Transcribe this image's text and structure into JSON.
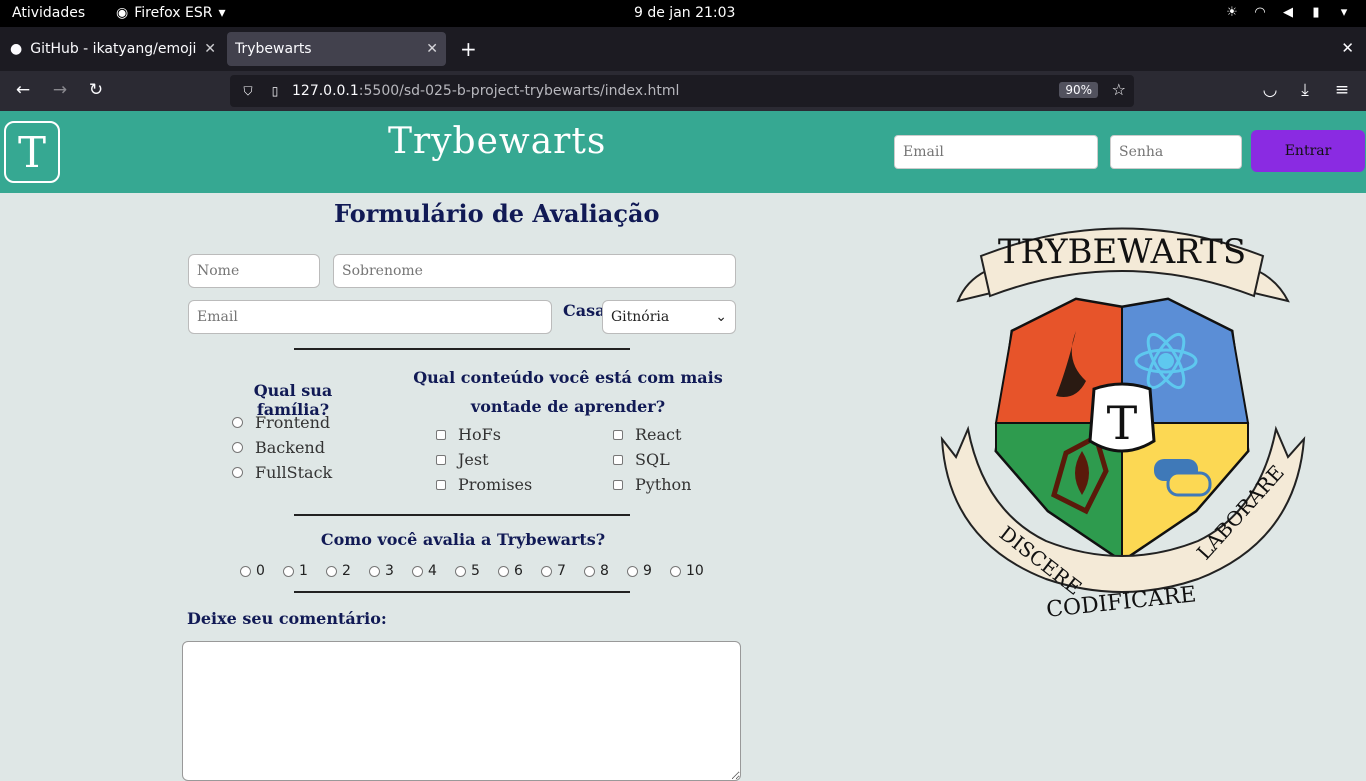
{
  "system": {
    "activities": "Atividades",
    "app": "Firefox ESR",
    "clock": "9 de jan  21:03"
  },
  "browser": {
    "tabs": [
      {
        "title": "GitHub - ikatyang/emoji-cheat-sheet"
      },
      {
        "title": "Trybewarts"
      }
    ],
    "url_host": "127.0.0.1",
    "url_path": ":5500/sd-025-b-project-trybewarts/index.html",
    "zoom": "90%"
  },
  "header": {
    "logo_letter": "T",
    "brand": "Trybewarts",
    "email_placeholder": "Email",
    "password_placeholder": "Senha",
    "login_label": "Entrar"
  },
  "form": {
    "title": "Formulário de Avaliação",
    "nome_placeholder": "Nome",
    "sobrenome_placeholder": "Sobrenome",
    "email_placeholder": "Email",
    "casa_label": "Casa:",
    "casa_selected": "Gitnória",
    "familia_title": "Qual sua família?",
    "familias": [
      "Frontend",
      "Backend",
      "FullStack"
    ],
    "conteudo_title": "Qual conteúdo você está com mais vontade de aprender?",
    "conteudos_col1": [
      "HoFs",
      "Jest",
      "Promises"
    ],
    "conteudos_col2": [
      "React",
      "SQL",
      "Python"
    ],
    "avalia_title": "Como você avalia a Trybewarts?",
    "ratings": [
      "0",
      "1",
      "2",
      "3",
      "4",
      "5",
      "6",
      "7",
      "8",
      "9",
      "10"
    ],
    "comment_label": "Deixe seu comentário:"
  },
  "crest": {
    "banner_top": "TRYBEWARTS",
    "center_letter": "T",
    "motto_left": "DISCERE",
    "motto_center": "CODIFICARE",
    "motto_right": "LABORARE",
    "colors": {
      "red": "#e7542a",
      "blue": "#5b8ed6",
      "green": "#2e9b4e",
      "yellow": "#fcd853"
    }
  }
}
